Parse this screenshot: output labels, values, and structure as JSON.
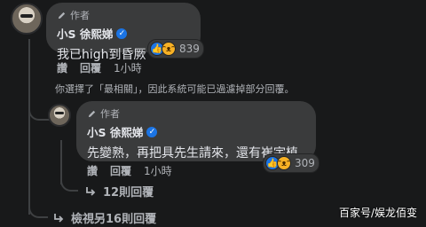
{
  "comment": {
    "author_badge": "作者",
    "name": "小S 徐熙娣",
    "text": "我已high到昏厥",
    "reaction_count": "839",
    "actions": {
      "like": "讚",
      "reply": "回覆",
      "time": "1小時"
    }
  },
  "filter_note": "你選擇了「最相關」，因此系統可能已過濾掉部分回覆。",
  "reply": {
    "author_badge": "作者",
    "name": "小S 徐熙娣",
    "text": "先變熟，再把具先生請來，還有崔宇植",
    "reaction_count": "309",
    "actions": {
      "like": "讚",
      "reply": "回覆",
      "time": "1小時"
    }
  },
  "more_replies_label": "12則回覆",
  "view_more_label": "檢視另16則回覆",
  "watermark": "百家号/娱龙佰变",
  "colors": {
    "background": "#18191a",
    "bubble": "#3a3b3c",
    "secondary_text": "#b0b3b8",
    "verified": "#1b74e4"
  }
}
